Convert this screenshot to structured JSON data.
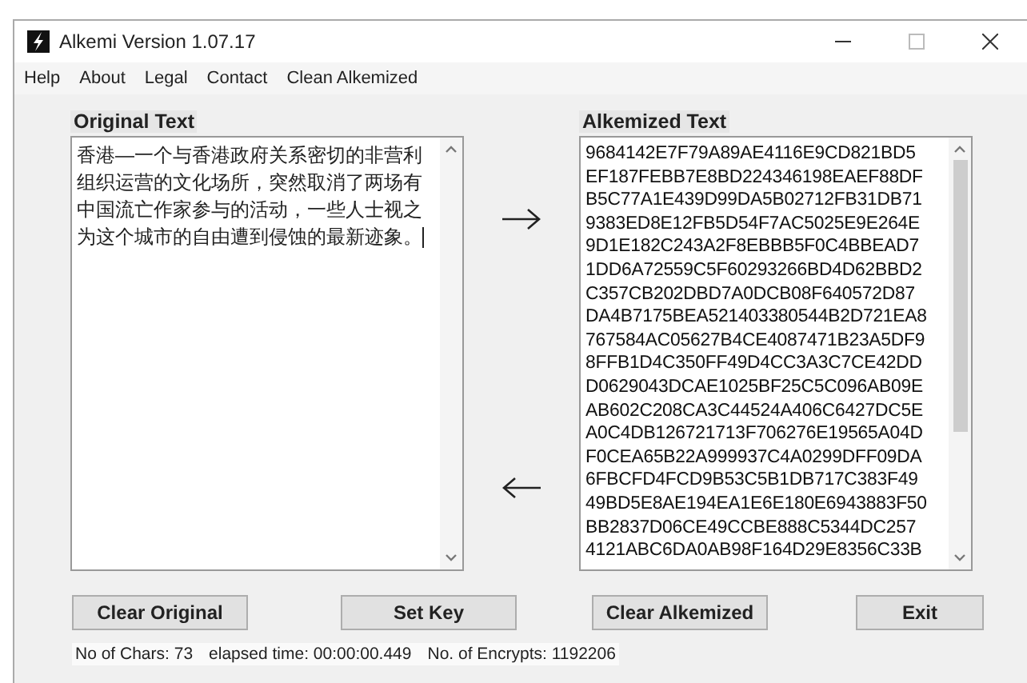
{
  "window": {
    "title": "Alkemi Version 1.07.17"
  },
  "menu": [
    "Help",
    "About",
    "Legal",
    "Contact",
    "Clean Alkemized"
  ],
  "original": {
    "label": "Original Text",
    "text": "香港—一个与香港政府关系密切的非营利组织运营的文化场所，突然取消了两场有中国流亡作家参与的活动，一些人士视之为这个城市的自由遭到侵蚀的最新迹象。"
  },
  "alkemized": {
    "label": "Alkemized Text",
    "lines": [
      "9684142E7F79A89AE4116E9CD821BD5",
      "EF187FEBB7E8BD224346198EAEF88DF",
      "B5C77A1E439D99DA5B02712FB31DB71",
      "9383ED8E12FB5D54F7AC5025E9E264E",
      "9D1E182C243A2F8EBBB5F0C4BBEAD7",
      "1DD6A72559C5F60293266BD4D62BBD2",
      "C357CB202DBD7A0DCB08F640572D87",
      "DA4B7175BEA521403380544B2D721EA8",
      "767584AC05627B4CE4087471B23A5DF9",
      "8FFB1D4C350FF49D4CC3A3C7CE42DD",
      "D0629043DCAE1025BF25C5C096AB09E",
      "AB602C208CA3C44524A406C6427DC5E",
      "A0C4DB126721713F706276E19565A04D",
      "F0CEA65B22A999937C4A0299DFF09DA",
      "6FBCFD4FCD9B53C5B1DB717C383F49",
      "49BD5E8AE194EA1E6E180E6943883F50",
      "BB2837D06CE49CCBE888C5344DC257",
      "4121ABC6DA0AB98F164D29E8356C33B"
    ]
  },
  "buttons": [
    "Clear Original",
    "Set Key",
    "Clear Alkemized",
    "Exit"
  ],
  "status": [
    "No of Chars: 73",
    "elapsed time: 00:00:00.449",
    "No. of Encrypts: 1192206"
  ]
}
